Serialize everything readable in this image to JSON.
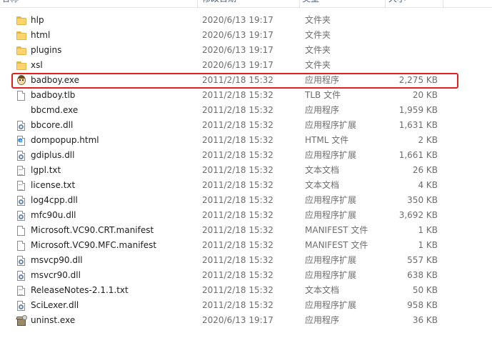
{
  "header": {
    "name": "名称",
    "date": "修改日期",
    "type": "类型",
    "size": "大小"
  },
  "files": [
    {
      "name": "hlp",
      "date": "2020/6/13 19:17",
      "type": "文件夹",
      "size": "",
      "icon": "folder-icon"
    },
    {
      "name": "html",
      "date": "2020/6/13 19:17",
      "type": "文件夹",
      "size": "",
      "icon": "folder-icon"
    },
    {
      "name": "plugins",
      "date": "2020/6/13 19:17",
      "type": "文件夹",
      "size": "",
      "icon": "folder-icon"
    },
    {
      "name": "xsl",
      "date": "2020/6/13 19:17",
      "type": "文件夹",
      "size": "",
      "icon": "folder-icon"
    },
    {
      "name": "badboy.exe",
      "date": "2011/2/18 15:32",
      "type": "应用程序",
      "size": "2,275 KB",
      "icon": "badboy-icon"
    },
    {
      "name": "badboy.tlb",
      "date": "2011/2/18 15:32",
      "type": "TLB 文件",
      "size": "20 KB",
      "icon": "file-icon"
    },
    {
      "name": "bbcmd.exe",
      "date": "2011/2/18 15:32",
      "type": "应用程序",
      "size": "1,959 KB",
      "icon": "blank-icon"
    },
    {
      "name": "bbcore.dll",
      "date": "2011/2/18 15:32",
      "type": "应用程序扩展",
      "size": "1,631 KB",
      "icon": "dll-icon"
    },
    {
      "name": "dompopup.html",
      "date": "2011/2/18 15:32",
      "type": "HTML 文件",
      "size": "2 KB",
      "icon": "html-icon"
    },
    {
      "name": "gdiplus.dll",
      "date": "2011/2/18 15:32",
      "type": "应用程序扩展",
      "size": "1,661 KB",
      "icon": "dll-icon"
    },
    {
      "name": "lgpl.txt",
      "date": "2011/2/18 15:32",
      "type": "文本文档",
      "size": "26 KB",
      "icon": "text-icon"
    },
    {
      "name": "license.txt",
      "date": "2011/2/18 15:32",
      "type": "文本文档",
      "size": "4 KB",
      "icon": "text-icon"
    },
    {
      "name": "log4cpp.dll",
      "date": "2011/2/18 15:32",
      "type": "应用程序扩展",
      "size": "350 KB",
      "icon": "dll-icon"
    },
    {
      "name": "mfc90u.dll",
      "date": "2011/2/18 15:32",
      "type": "应用程序扩展",
      "size": "3,692 KB",
      "icon": "dll-icon"
    },
    {
      "name": "Microsoft.VC90.CRT.manifest",
      "date": "2011/2/18 15:32",
      "type": "MANIFEST 文件",
      "size": "1 KB",
      "icon": "file-icon"
    },
    {
      "name": "Microsoft.VC90.MFC.manifest",
      "date": "2011/2/18 15:32",
      "type": "MANIFEST 文件",
      "size": "1 KB",
      "icon": "file-icon"
    },
    {
      "name": "msvcp90.dll",
      "date": "2011/2/18 15:32",
      "type": "应用程序扩展",
      "size": "557 KB",
      "icon": "dll-icon"
    },
    {
      "name": "msvcr90.dll",
      "date": "2011/2/18 15:32",
      "type": "应用程序扩展",
      "size": "638 KB",
      "icon": "dll-icon"
    },
    {
      "name": "ReleaseNotes-2.1.1.txt",
      "date": "2011/2/18 15:32",
      "type": "文本文档",
      "size": "50 KB",
      "icon": "text-icon"
    },
    {
      "name": "SciLexer.dll",
      "date": "2011/2/18 15:32",
      "type": "应用程序扩展",
      "size": "958 KB",
      "icon": "dll-icon"
    },
    {
      "name": "uninst.exe",
      "date": "2020/6/13 19:17",
      "type": "应用程序",
      "size": "36 KB",
      "icon": "installer-icon"
    }
  ],
  "highlight_color": "#e0201c"
}
